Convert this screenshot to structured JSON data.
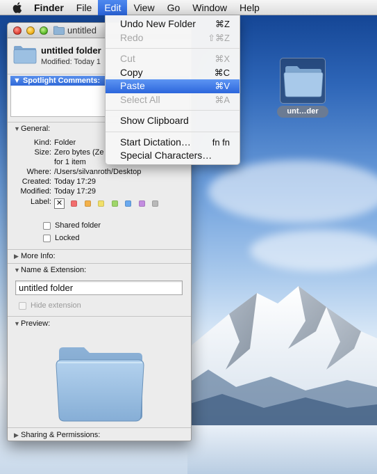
{
  "menubar": {
    "apple_icon": "apple-logo-icon",
    "items": [
      {
        "label": "Finder"
      },
      {
        "label": "File"
      },
      {
        "label": "Edit"
      },
      {
        "label": "View"
      },
      {
        "label": "Go"
      },
      {
        "label": "Window"
      },
      {
        "label": "Help"
      }
    ],
    "active_menu": "Edit"
  },
  "edit_menu": {
    "items": [
      {
        "label": "Undo New Folder",
        "shortcut": "⌘Z",
        "enabled": true
      },
      {
        "label": "Redo",
        "shortcut": "⇧⌘Z",
        "enabled": false
      },
      {
        "label": "Cut",
        "shortcut": "⌘X",
        "enabled": false
      },
      {
        "label": "Copy",
        "shortcut": "⌘C",
        "enabled": true
      },
      {
        "label": "Paste",
        "shortcut": "⌘V",
        "enabled": true,
        "highlighted": true
      },
      {
        "label": "Select All",
        "shortcut": "⌘A",
        "enabled": false
      },
      {
        "label": "Show Clipboard",
        "shortcut": "",
        "enabled": true
      },
      {
        "label": "Start Dictation…",
        "shortcut": "fn fn",
        "enabled": true
      },
      {
        "label": "Special Characters…",
        "shortcut": "",
        "enabled": true
      }
    ]
  },
  "info_window": {
    "title": "untitled",
    "name": "untitled folder",
    "modified_line": "Modified: Today 1",
    "spotlight_label": "Spotlight Comments:",
    "general_label": "General:",
    "general": {
      "kind_label": "Kind:",
      "kind": "Folder",
      "size_label": "Size:",
      "size": "Zero bytes (Ze",
      "size_line2": "for 1 item",
      "where_label": "Where:",
      "where": "/Users/silvanroth/Desktop",
      "created_label": "Created:",
      "created": "Today 17:29",
      "modified_label": "Modified:",
      "modified": "Today 17:29",
      "label_label": "Label:",
      "label_x": "✕",
      "label_colors": [
        "#f26d6d",
        "#f3b14a",
        "#f1e06b",
        "#9fd66a",
        "#6aa9ee",
        "#c38de0",
        "#b9b9b9"
      ]
    },
    "shared_folder": "Shared folder",
    "locked": "Locked",
    "more_info_label": "More Info:",
    "name_ext_label": "Name & Extension:",
    "name_field_value": "untitled folder",
    "hide_extension": "Hide extension",
    "preview_label": "Preview:",
    "sharing_label": "Sharing & Permissions:"
  },
  "desktop": {
    "folder_label": "unt…der",
    "folder_icon": "folder-icon"
  }
}
